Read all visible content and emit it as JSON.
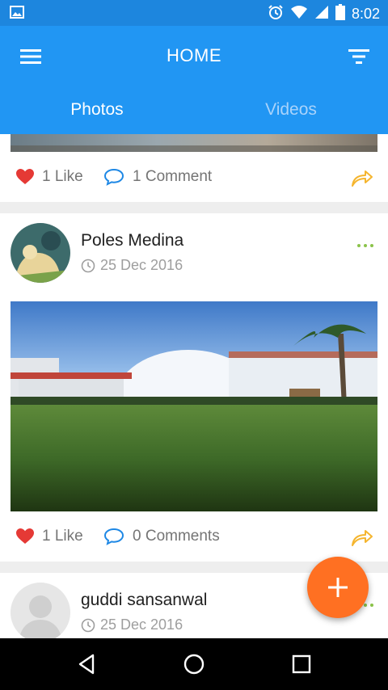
{
  "status_bar": {
    "time": "8:02",
    "icons": [
      "image-notification-icon",
      "alarm-icon",
      "wifi-icon",
      "signal-icon",
      "battery-icon"
    ]
  },
  "app_bar": {
    "title": "HOME",
    "tabs": [
      {
        "label": "Photos",
        "active": true
      },
      {
        "label": "Videos",
        "active": false
      }
    ]
  },
  "feed": {
    "posts": [
      {
        "author": "",
        "date": "",
        "likes_label": "1 Like",
        "comments_label": "1 Comment"
      },
      {
        "author": "Poles Medina",
        "date": "25 Dec 2016",
        "likes_label": "1 Like",
        "comments_label": "0 Comments"
      },
      {
        "author": "guddi sansanwal",
        "date": "25 Dec 2016"
      }
    ]
  },
  "fab": {
    "icon": "plus-icon"
  },
  "nav_bar": {
    "icons": [
      "back-icon",
      "home-icon",
      "recents-icon"
    ]
  },
  "colors": {
    "primary": "#2196f3",
    "status_bar": "#1d86de",
    "accent_fab": "#ff7022",
    "like_heart": "#e53935",
    "comment_icon": "#1e88e5",
    "share_icon": "#f5b52e",
    "more_dots": "#8bc34a"
  }
}
